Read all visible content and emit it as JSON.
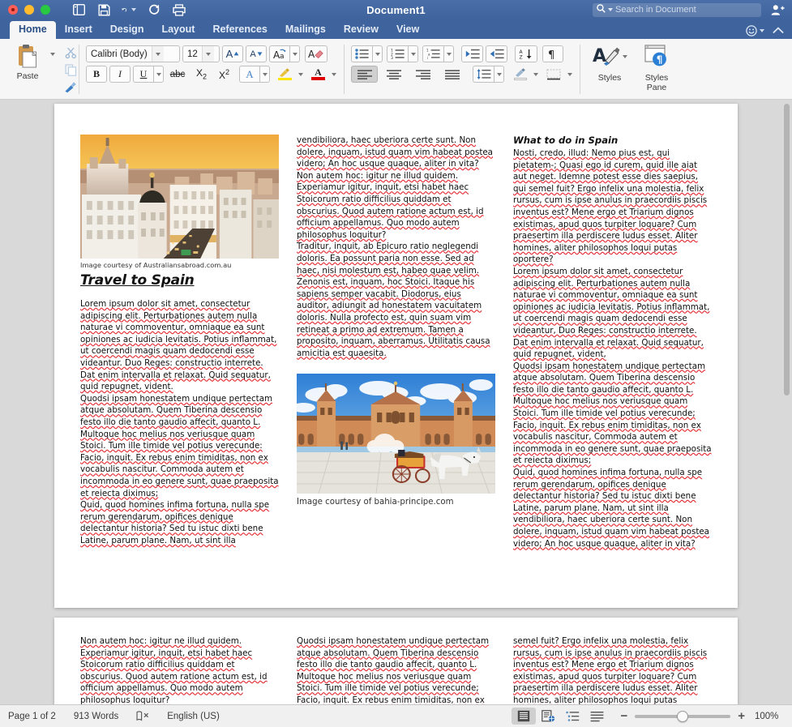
{
  "window": {
    "title": "Document1",
    "traffic_lights": [
      "close",
      "minimize",
      "maximize"
    ]
  },
  "quick_access": [
    {
      "name": "sidebar-toggle-icon",
      "label": "Sidebar"
    },
    {
      "name": "save-icon",
      "label": "Save"
    },
    {
      "name": "undo-icon",
      "label": "Undo"
    },
    {
      "name": "redo-icon",
      "label": "Redo"
    },
    {
      "name": "print-icon",
      "label": "Print"
    }
  ],
  "search": {
    "placeholder": "Search in Document",
    "value": "",
    "icon": "search-icon"
  },
  "share_icon": "share-person-icon",
  "tabs": [
    {
      "label": "Home",
      "active": true
    },
    {
      "label": "Insert",
      "active": false
    },
    {
      "label": "Design",
      "active": false
    },
    {
      "label": "Layout",
      "active": false
    },
    {
      "label": "References",
      "active": false
    },
    {
      "label": "Mailings",
      "active": false
    },
    {
      "label": "Review",
      "active": false
    },
    {
      "label": "View",
      "active": false
    }
  ],
  "ribbon": {
    "clipboard": {
      "paste_label": "Paste",
      "cut_icon": "scissors-icon",
      "copy_icon": "copy-icon",
      "format_painter_icon": "format-painter-icon"
    },
    "font": {
      "font_name": "Calibri (Body)",
      "font_size": "12",
      "grow_font": "A",
      "shrink_font": "A",
      "change_case": "Aa",
      "clear_formatting": "clear-formatting-icon",
      "bold": "B",
      "italic": "I",
      "underline": "U",
      "strikethrough": "abc",
      "subscript": "X2",
      "superscript": "X2",
      "text_effects": "A",
      "highlight_color": "highlight-icon",
      "font_color": "A",
      "highlight_swatch": "#ffe400",
      "font_color_swatch": "#e00000"
    },
    "paragraph": {
      "bullets": "bullet-list-icon",
      "numbering": "numbered-list-icon",
      "multilevel": "multilevel-list-icon",
      "decrease_indent": "decrease-indent-icon",
      "increase_indent": "increase-indent-icon",
      "sort": "sort-az-icon",
      "show_marks": "pilcrow-icon",
      "align_left": "align-left-icon",
      "align_center": "align-center-icon",
      "align_right": "align-right-icon",
      "justify": "align-justify-icon",
      "line_spacing": "line-spacing-icon",
      "shading": "shading-icon",
      "borders": "borders-icon"
    },
    "styles": {
      "styles_label": "Styles",
      "styles_pane_label": "Styles\nPane",
      "styles_line1": "Styles",
      "styles_pane_line1": "Styles",
      "styles_pane_line2": "Pane"
    }
  },
  "document": {
    "page1": {
      "col1": {
        "image": {
          "name": "madrid-skyline-image",
          "alt": "Madrid skyline at sunset"
        },
        "caption": "Image courtesy of Australiansabroad.com.au",
        "heading": "Travel to Spain",
        "paragraphs": [
          "Lorem ipsum dolor sit amet, consectetur adipiscing elit. Perturbationes autem nulla naturae vi commoventur, omniaque ea sunt opiniones ac iudicia levitatis. Potius inflammat, ut coercendi magis quam dedocendi esse videantur. Duo Reges: constructio interrete. Dat enim intervalla et relaxat. Quid sequatur, quid repugnet, vident.",
          "Quodsi ipsam honestatem undique pertectam atque absolutam. Quem Tiberina descensio festo illo die tanto gaudio affecit, quanto L. Multoque hoc melius nos veriusque quam Stoici. Tum ille timide vel potius verecunde: Facio, inquit. Ex rebus enim timiditas, non ex vocabulis nascitur. Commoda autem et incommoda in eo genere sunt, quae praeposita et reiecta diximus;",
          "Quid, quod homines infima fortuna, nulla spe rerum gerendarum, opifices denique delectantur historia? Sed tu istuc dixti bene Latine, parum plane. Nam, ut sint illa"
        ]
      },
      "col2": {
        "paragraphs": [
          "vendibiliora, haec uberiora certe sunt. Non dolere, inquam, istud quam vim habeat postea videro; An hoc usque quaque, aliter in vita?",
          "Non autem hoc: igitur ne illud quidem. Experiamur igitur, inquit, etsi habet haec Stoicorum ratio difficilius quiddam et obscurius. Quod autem ratione actum est, id officium appellamus. Quo modo autem philosophus loquitur?",
          "Traditur, inquit, ab Epicuro ratio neglegendi doloris. Ea possunt paria non esse. Sed ad haec, nisi molestum est, habeo quae velim. Zenonis est, inquam, hoc Stoici. Itaque his sapiens semper vacabit. Diodorus, eius auditor, adiungit ad honestatem vacuitatem doloris. Nulla profecto est, quin suam vim retineat a primo ad extremum. Tamen a proposito, inquam, aberramus. Utilitatis causa amicitia est quaesita."
        ],
        "image": {
          "name": "plaza-espana-seville-image",
          "alt": "Plaza de Espana Seville with horse carriage"
        },
        "caption": "Image courtesy of bahia-principe.com"
      },
      "col3": {
        "heading": "What to do in Spain",
        "paragraphs": [
          "Nosti, credo, illud: Nemo pius est, qui pietatem-; Quasi ego id curem, quid ille aiat aut neget. Idemne potest esse dies saepius, qui semel fuit? Ergo infelix una molestia, felix rursus, cum is ipse anulus in praecordiis piscis inventus est? Mene ergo et Triarium dignos existimas, apud quos turpiter loquare? Cum praesertim illa perdiscere ludus esset. Aliter homines, aliter philosophos loqui putas oportere?",
          "Lorem ipsum dolor sit amet, consectetur adipiscing elit. Perturbationes autem nulla naturae vi commoventur, omniaque ea sunt opiniones ac iudicia levitatis. Potius inflammat, ut coercendi magis quam dedocendi esse videantur, Duo Reges: constructio interrete. Dat enim intervalla et relaxat. Quid sequatur, quid repugnet, vident,",
          "Quodsi ipsam honestatem undique pertectam atque absolutam. Quem Tiberina descensio festo illo die tanto gaudio affecit, quanto L. Multoque hoc melius nos veriusque quam Stoici. Tum ille timide vel potius verecunde; Facio, inquit. Ex rebus enim timiditas, non ex vocabulis nascitur, Commoda autem et incommoda in eo genere sunt, quae praeposita et reiecta diximus;",
          "Quid, quod homines infima fortuna, nulla spe rerum gerendarum, opifices denique delectantur historia? Sed tu istuc dixti bene Latine, parum plane. Nam, ut sint illa vendibiliora, haec uberiora certe sunt. Non dolere, inquam, istud quam vim habeat postea videro; An hoc usque quaque, aliter in vita?"
        ]
      }
    },
    "page2": {
      "col1": "Non autem hoc: igitur ne illud quidem. Experiamur igitur, inquit, etsi habet haec Stoicorum ratio difficilius quiddam et obscurius. Quod autem ratione actum est, id officium appellamus. Quo modo autem philosophus loquitur?",
      "col2": "Quodsi ipsam honestatem undique pertectam atque absolutam. Quem Tiberina descensio festo illo die tanto gaudio affecit, quanto L. Multoque hoc melius nos veriusque quam Stoici. Tum ille timide vel potius verecunde; Facio, inquit. Ex rebus enim timiditas, non ex",
      "col3": "semel fuit? Ergo infelix una molestia, felix rursus, cum is ipse anulus in praecordiis piscis inventus est? Mene ergo et Triarium dignos existimas, apud quos turpiter loquare? Cum praesertim illa perdiscere ludus esset. Aliter homines, aliter philosophos loqui putas"
    }
  },
  "status": {
    "page_info": "Page 1 of 2",
    "word_count": "913 Words",
    "proofing_icon": "proofing-errors-icon",
    "language": "English (US)",
    "views": [
      {
        "name": "print-layout-view",
        "active": true
      },
      {
        "name": "web-layout-view",
        "active": false
      },
      {
        "name": "outline-view",
        "active": false
      },
      {
        "name": "draft-view",
        "active": false
      }
    ],
    "zoom_out": "−",
    "zoom_in": "+",
    "zoom_value": "100%"
  }
}
